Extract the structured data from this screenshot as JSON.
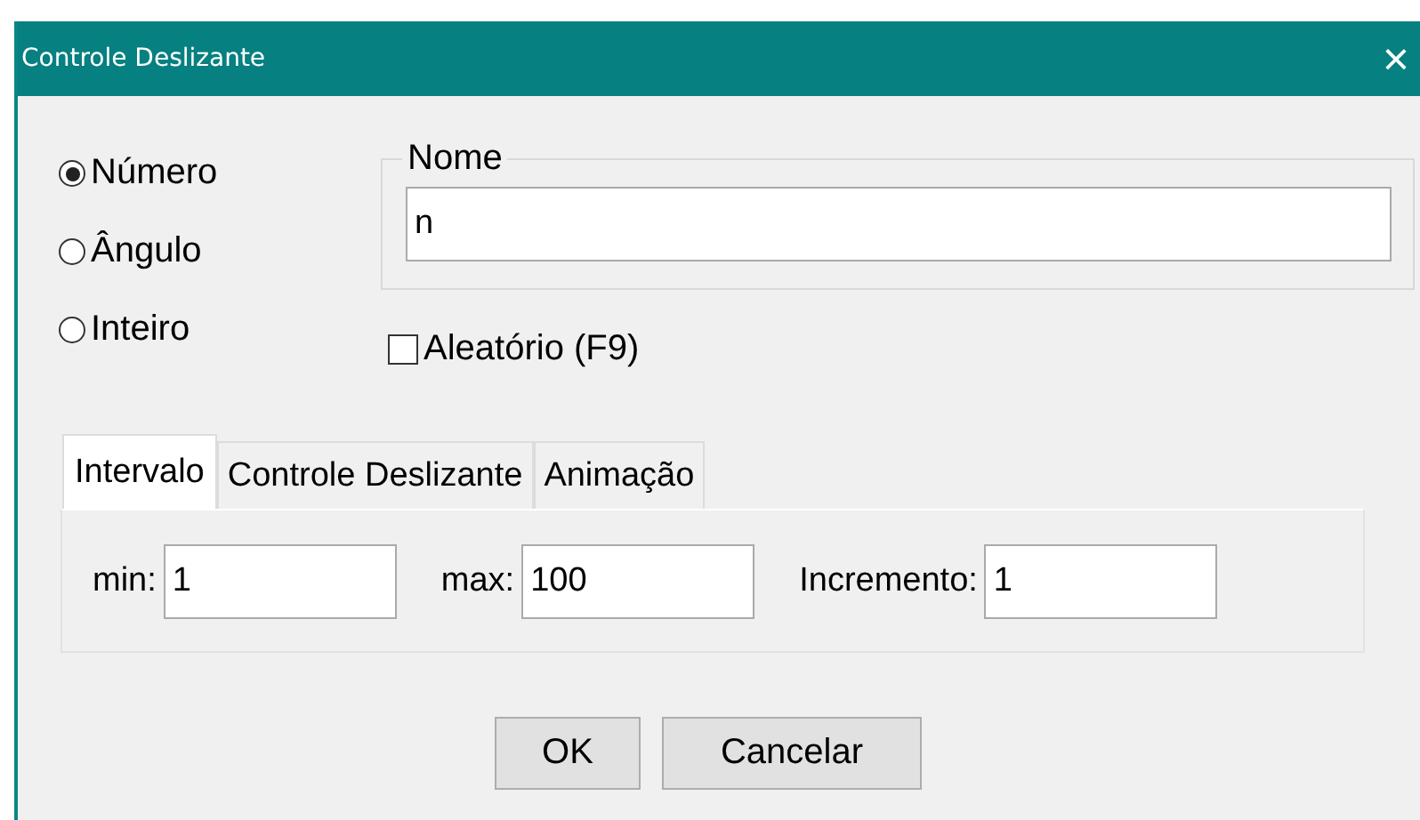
{
  "window": {
    "title": "Controle Deslizante",
    "close": "×"
  },
  "types": [
    {
      "label": "Número",
      "selected": true
    },
    {
      "label": "Ângulo",
      "selected": false
    },
    {
      "label": "Inteiro",
      "selected": false
    }
  ],
  "name_group": {
    "legend": "Nome",
    "value": "n"
  },
  "random": {
    "label": "Aleatório (F9)",
    "checked": false
  },
  "tabs": [
    {
      "label": "Intervalo",
      "selected": true
    },
    {
      "label": "Controle Deslizante",
      "selected": false
    },
    {
      "label": "Animação",
      "selected": false
    }
  ],
  "fields": [
    {
      "label": "min:",
      "value": "1"
    },
    {
      "label": "max:",
      "value": "100"
    },
    {
      "label": "Incremento:",
      "value": "1"
    }
  ],
  "buttons": [
    "OK",
    "Cancelar"
  ]
}
